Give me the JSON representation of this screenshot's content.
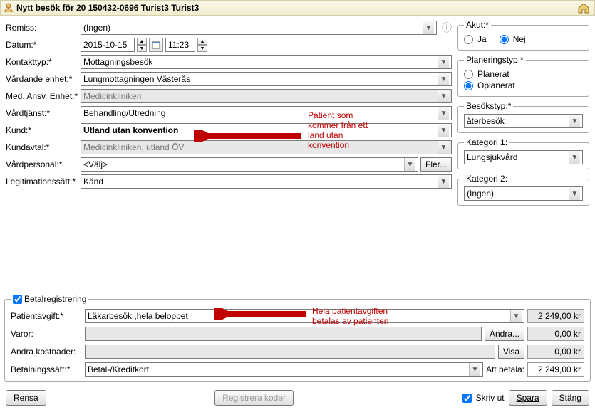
{
  "title": "Nytt besök för 20 150432-0696 Turist3 Turist3",
  "labels": {
    "remiss": "Remiss:",
    "datum": "Datum:*",
    "kontakttyp": "Kontakttyp:*",
    "vardande": "Vårdande enhet:*",
    "medansv": "Med. Ansv. Enhet:*",
    "vardtjanst": "Vårdtjänst:*",
    "kund": "Kund:*",
    "kundavtal": "Kundavtal:*",
    "vardpersonal": "Vårdpersonal:*",
    "legitimation": "Legitimationssätt:*",
    "akut": "Akut:*",
    "ja": "Ja",
    "nej": "Nej",
    "planeringstyp": "Planeringstyp:*",
    "planerat": "Planerat",
    "oplanerat": "Oplanerat",
    "besokstyp": "Besökstyp:*",
    "kategori1": "Kategori 1:",
    "kategori2": "Kategori 2:",
    "fler": "Fler...",
    "betalreg": "Betalregistrering",
    "patientavgift": "Patientavgift:*",
    "varor": "Varor:",
    "andrakost": "Andra kostnader:",
    "betalningssatt": "Betalningssätt:*",
    "attbetala": "Att betala:",
    "andra": "Ändra...",
    "visa": "Visa",
    "rensa": "Rensa",
    "regkoder": "Registrera koder",
    "skrivut": "Skriv ut",
    "spara": "Spara",
    "stang": "Stäng"
  },
  "values": {
    "remiss": "(Ingen)",
    "date": "2015-10-15",
    "time": "11:23",
    "kontakttyp": "Mottagningsbesök",
    "vardande": "Lungmottagningen Västerås",
    "medansv": "Medicinkliniken",
    "vardtjanst": "Behandling/Utredning",
    "kund": "Utland utan konvention",
    "kundavtal": "Medicinkliniken, utland ÖV",
    "vardpersonal": "<Välj>",
    "legitimation": "Känd",
    "besokstyp": "återbesök",
    "kategori1": "Lungsjukvård",
    "kategori2": "(Ingen)",
    "patientavgift": "Läkarbesök ,hela beloppet",
    "betalningssatt": "Betal-/Kreditkort",
    "amount_pat": "2 249,00 kr",
    "amount_varor": "0,00 kr",
    "amount_andra": "0,00 kr",
    "amount_total": "2 249,00 kr"
  },
  "annotations": {
    "line1": "Patient som",
    "line2": "kommer från ett",
    "line3": "land utan",
    "line4": "konvention",
    "pay1": "Hela patientavgiften",
    "pay2": "betalas av patienten"
  }
}
